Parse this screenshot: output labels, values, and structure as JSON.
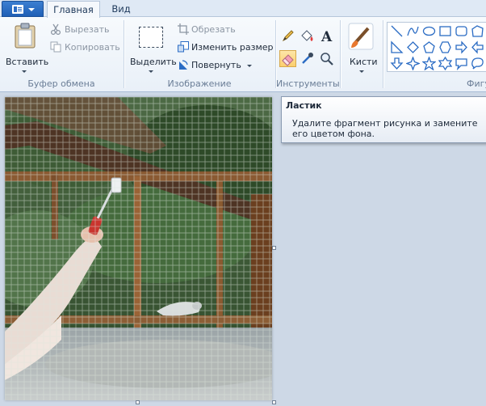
{
  "tabs": {
    "file_icon": "paint-menu-icon",
    "home": "Главная",
    "view": "Вид"
  },
  "clipboard": {
    "label": "Буфер обмена",
    "paste": "Вставить",
    "cut": "Вырезать",
    "copy": "Копировать"
  },
  "image": {
    "label": "Изображение",
    "select": "Выделить",
    "crop": "Обрезать",
    "resize": "Изменить размер",
    "rotate": "Повернуть"
  },
  "tools": {
    "label": "Инструменты",
    "items": [
      "pencil-icon",
      "fill-icon",
      "text-icon",
      "eraser-icon",
      "color-picker-icon",
      "magnifier-icon"
    ],
    "active": "eraser-icon"
  },
  "brushes": {
    "label": "Кисти"
  },
  "shapes": {
    "label": "Фигуры",
    "label_visible": "Фигу"
  },
  "tooltip": {
    "title": "Ластик",
    "body": "Удалите фрагмент рисунка и замените его цветом фона."
  },
  "colors": {
    "accent": "#2b6cc4",
    "ribbon_bg": "#f5f8fc",
    "workspace": "#cdd8e6",
    "active_tool": "#fbcf6e"
  }
}
